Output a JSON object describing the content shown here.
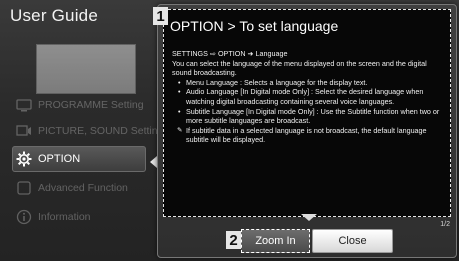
{
  "app": {
    "title": "User Guide"
  },
  "sidebar": {
    "items": [
      {
        "label": "PROGRAMME Setting",
        "icon": "tv-icon"
      },
      {
        "label": "PICTURE, SOUND Setting",
        "icon": "picture-sound-icon"
      },
      {
        "label": "OPTION",
        "icon": "gear-icon",
        "active": true
      },
      {
        "label": "Advanced Function",
        "icon": "advanced-icon"
      },
      {
        "label": "Information",
        "icon": "info-icon"
      }
    ]
  },
  "dialog": {
    "badge": "1",
    "title": "OPTION > To set language",
    "path": "SETTINGS ⇨ OPTION ➜ Language",
    "intro": "You can select the language of the menu displayed on the screen and the digital sound broadcasting.",
    "bullets": [
      "Menu Language : Selects a language for the display text.",
      "Audio Language  [In Digital mode Only] : Select the desired language when watching digital broadcasting containing several voice languages.",
      "Subtitle Language [In Digital mode Only] : Use the Subtitle function when two or more subtitle languages are broadcast."
    ],
    "note": "If subtitle data in a selected language is not broadcast, the default language subtitle will be displayed.",
    "page_indicator": "1/2",
    "buttons": {
      "badge": "2",
      "zoom_in": "Zoom In",
      "close": "Close"
    }
  }
}
